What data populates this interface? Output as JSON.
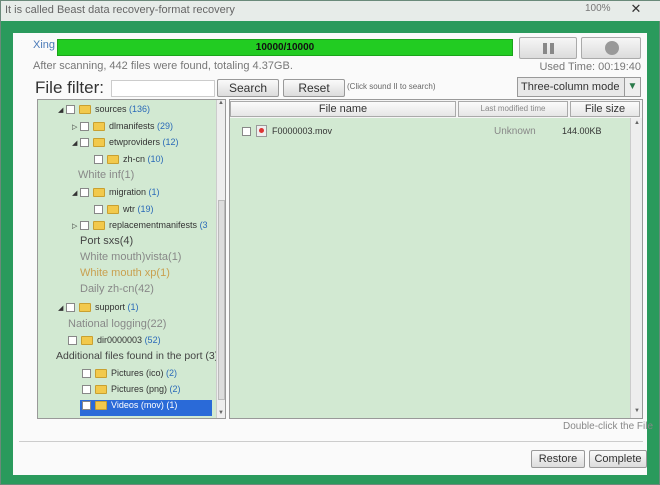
{
  "window": {
    "title": "It is called Beast data recovery-format recovery",
    "minimize_label": "100%",
    "close_label": "✕"
  },
  "scan": {
    "label": "Xing",
    "progress_text": "10000/10000",
    "progress_fraction": 1.0,
    "summary": "After scanning, 442 files were found, totaling 4.37GB.",
    "used_time": "Used Time: 00:19:40"
  },
  "toolbar": {
    "filter_label": "File filter:",
    "filter_placeholder": "",
    "search_label": "Search",
    "reset_label": "Reset",
    "hint": "(Click sound II to search)",
    "mode_value": "Three-column mode",
    "mode_arrow": "▼"
  },
  "tree": {
    "items": [
      {
        "toggle": "◢",
        "label": "sources",
        "count": "(136)"
      },
      {
        "toggle": "▷",
        "label": "dlmanifests",
        "count": "(29)"
      },
      {
        "toggle": "◢",
        "label": "etwproviders",
        "count": "(12)"
      },
      {
        "toggle": "",
        "label": "zh-cn",
        "count": "(10)"
      },
      {
        "toggle": "◢",
        "label": "migration",
        "count": "(1)"
      },
      {
        "toggle": "",
        "label": "wtr",
        "count": "(19)"
      },
      {
        "toggle": "▷",
        "label": "replacementmanifests",
        "count": "(3"
      },
      {
        "toggle": "◢",
        "label": "support",
        "count": "(1)"
      },
      {
        "toggle": "",
        "label": "dir0000003",
        "count": "(52)"
      },
      {
        "toggle": "",
        "label": "Pictures (ico)",
        "count": "(2)"
      },
      {
        "toggle": "",
        "label": "Pictures (png)",
        "count": "(2)"
      },
      {
        "toggle": "",
        "label": "Videos (mov)",
        "count": "(1)"
      }
    ],
    "plain": {
      "white_inf": "White inf(1)",
      "port_sxs": "Port sxs(4)",
      "white_vista": "White mouth)vista(1)",
      "white_xp": "White mouth xp(1)",
      "daily_zhcn": "Daily zh-cn(42)",
      "national_logging": "National logging(22)",
      "additional_files": "Additional files found in the port (3)"
    }
  },
  "files": {
    "headers": {
      "name": "File name",
      "modified": "Last modified time",
      "size": "File size"
    },
    "rows": [
      {
        "name": "F0000003.mov",
        "modified": "Unknown",
        "size": "144.00KB"
      }
    ]
  },
  "footer": {
    "hint": "Double-click the File",
    "restore_label": "Restore",
    "complete_label": "Complete"
  },
  "colors": {
    "frame": "#2a9a5c",
    "progress": "#22cc22",
    "tree_bg": "#d2e9d2",
    "selected": "#2a6ad8",
    "count_blue": "#2a6ab8"
  }
}
